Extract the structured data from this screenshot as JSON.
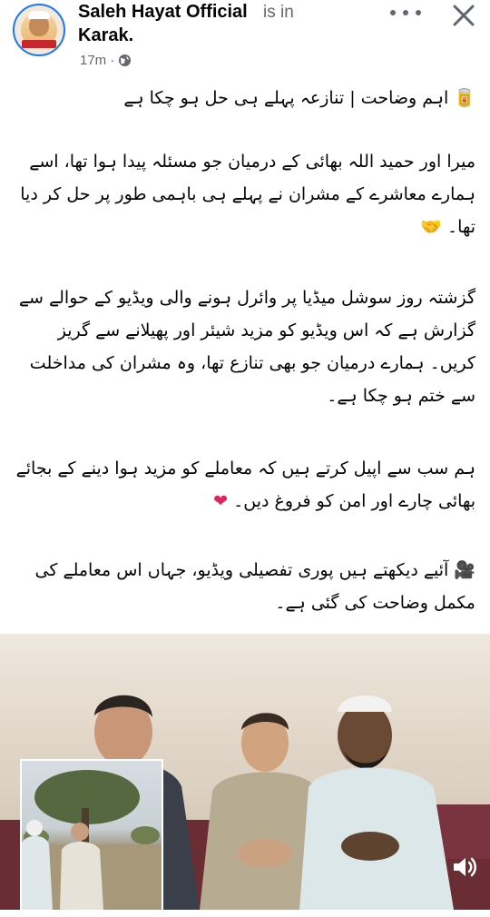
{
  "header": {
    "page_name": "Saleh Hayat Official",
    "is_in_text": "is in",
    "location": "Karak.",
    "time": "17m",
    "separator": "·",
    "privacy_icon": "globe-icon",
    "more_icon": "more-dots-icon",
    "close_icon": "close-icon"
  },
  "post": {
    "paragraphs": [
      {
        "emoji_before": "🥫",
        "text": "اہم وضاحت | تنازعہ پہلے ہی حل ہو چکا ہے"
      },
      {
        "text": "میرا اور حمید اللہ بھائی کے درمیان جو مسئلہ پیدا ہوا تھا، اسے ہمارے معاشرے کے مشران نے پہلے ہی باہمی طور پر حل کر دیا تھا۔",
        "emoji_after": "🤝"
      },
      {
        "text": "گزشتہ روز سوشل میڈیا پر وائرل ہونے والی ویڈیو کے حوالے سے گزارش ہے کہ اس ویڈیو کو مزید شیئر اور پھیلانے سے گریز کریں۔ ہمارے درمیان جو بھی تنازع تھا، وہ مشران کی مداخلت سے ختم ہو چکا ہے۔"
      },
      {
        "text": "ہم سب سے اپیل کرتے ہیں کہ معاملے کو مزید ہوا دینے کے بجائے بھائی چارے اور امن کو فروغ دیں۔",
        "emoji_after": "❤"
      },
      {
        "emoji_before": "🎥",
        "text": "آئیے دیکھتے ہیں پوری تفصیلی ویڈیو، جہاں اس معاملے کی مکمل وضاحت کی گئی ہے۔"
      }
    ]
  },
  "video": {
    "volume_icon": "volume-icon",
    "overlay_icon": "inset-video-thumbnail"
  },
  "colors": {
    "accent": "#1877f2",
    "secondary_text": "#65676b",
    "heart": "#e0245e"
  }
}
